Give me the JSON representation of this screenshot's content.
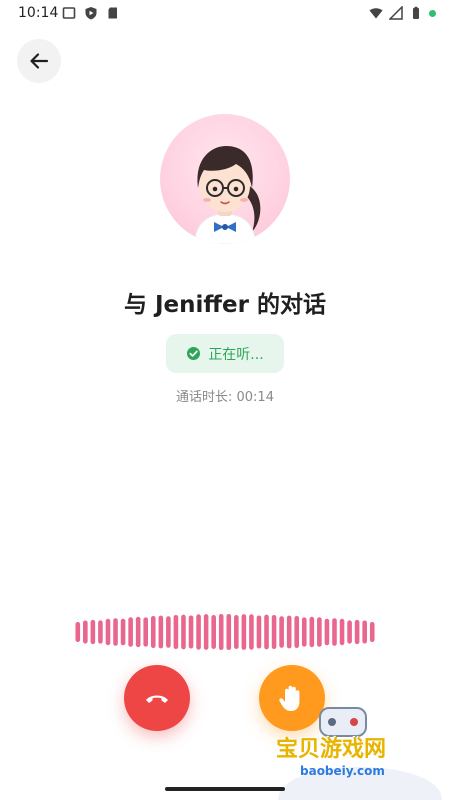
{
  "status_bar": {
    "time": "10:14",
    "left_icons": [
      "screen-icon",
      "shield-play-icon",
      "sd-card-icon"
    ],
    "right_icons": [
      "wifi-icon",
      "signal-icon",
      "battery-icon",
      "status-dot"
    ]
  },
  "header": {
    "back_icon": "back-arrow-icon"
  },
  "call": {
    "title": "与 Jeniffer 的对话",
    "status_label": "正在听...",
    "duration_text": "通话时长: 00:14"
  },
  "colors": {
    "listening_green": "#2fa55a",
    "hangup_red": "#ee4545",
    "mute_orange": "#ff9a1f",
    "wave_pink": "#e9668f"
  },
  "waveform": {
    "bars": 40
  },
  "watermark": {
    "cn": "宝贝游戏网",
    "en": "baobeiy.com"
  }
}
